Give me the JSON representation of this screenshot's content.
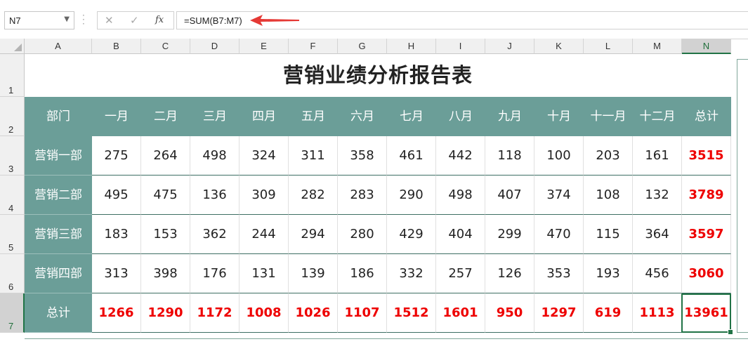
{
  "formula_bar": {
    "name_box": "N7",
    "cancel_icon": "✕",
    "enter_icon": "✓",
    "fx_label": "fx",
    "formula": "=SUM(B7:M7)"
  },
  "columns": [
    "A",
    "B",
    "C",
    "D",
    "E",
    "F",
    "G",
    "H",
    "I",
    "J",
    "K",
    "L",
    "M",
    "N"
  ],
  "rows": [
    "1",
    "2",
    "3",
    "4",
    "5",
    "6",
    "7"
  ],
  "selected_cell": "N7",
  "title": "营销业绩分析报告表",
  "header": [
    "部门",
    "一月",
    "二月",
    "三月",
    "四月",
    "五月",
    "六月",
    "七月",
    "八月",
    "九月",
    "十月",
    "十一月",
    "十二月",
    "总计"
  ],
  "body": [
    {
      "dept": "营销一部",
      "values": [
        "275",
        "264",
        "498",
        "324",
        "311",
        "358",
        "461",
        "442",
        "118",
        "100",
        "203",
        "161"
      ],
      "total": "3515"
    },
    {
      "dept": "营销二部",
      "values": [
        "495",
        "475",
        "136",
        "309",
        "282",
        "283",
        "290",
        "498",
        "407",
        "374",
        "108",
        "132"
      ],
      "total": "3789"
    },
    {
      "dept": "营销三部",
      "values": [
        "183",
        "153",
        "362",
        "244",
        "294",
        "280",
        "429",
        "404",
        "299",
        "470",
        "115",
        "364"
      ],
      "total": "3597"
    },
    {
      "dept": "营销四部",
      "values": [
        "313",
        "398",
        "176",
        "131",
        "139",
        "186",
        "332",
        "257",
        "126",
        "353",
        "193",
        "456"
      ],
      "total": "3060"
    }
  ],
  "totals_row": {
    "label": "总计",
    "values": [
      "1266",
      "1290",
      "1172",
      "1008",
      "1026",
      "1107",
      "1512",
      "1601",
      "950",
      "1297",
      "619",
      "1113"
    ],
    "total": "13961"
  },
  "colors": {
    "header_bg": "#6b9e98",
    "total_text": "#ee0000",
    "selection": "#217346",
    "arrow": "#e53935"
  }
}
